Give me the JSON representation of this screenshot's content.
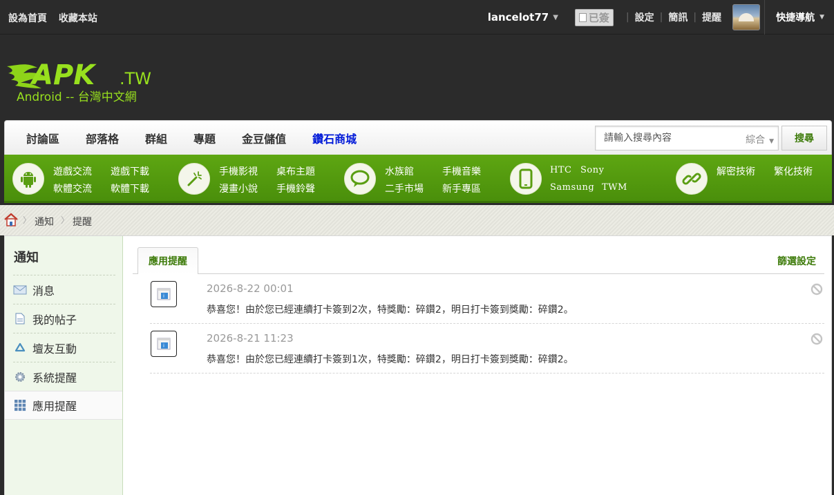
{
  "topbar": {
    "set_home": "設為首頁",
    "bookmark": "收藏本站",
    "username": "lancelot77",
    "signed_label": "已簽",
    "settings": "設定",
    "messages": "簡訊",
    "reminders": "提醒",
    "quick_nav": "快捷導航"
  },
  "logo": {
    "main": "APK",
    "suffix": ".TW",
    "sub": "Android -- 台灣中文網"
  },
  "nav": {
    "items": [
      "討論區",
      "部落格",
      "群組",
      "專題",
      "金豆儲值",
      "鑽石商城"
    ],
    "search_placeholder": "請輸入搜尋內容",
    "search_category": "綜合",
    "search_button": "搜尋"
  },
  "categories": [
    {
      "icon": "android-icon",
      "row1": [
        "遊戲交流",
        "遊戲下載"
      ],
      "row2": [
        "軟體交流",
        "軟體下載"
      ]
    },
    {
      "icon": "magic-wand-icon",
      "row1": [
        "手機影視",
        "桌布主題"
      ],
      "row2": [
        "漫畫小說",
        "手機鈴聲"
      ]
    },
    {
      "icon": "chat-bubble-icon",
      "row1": [
        "水族館",
        "手機音樂"
      ],
      "row2": [
        "二手市場",
        "新手專區"
      ]
    },
    {
      "icon": "phone-icon",
      "row1": [
        "HTC",
        "Sony"
      ],
      "row2": [
        "Samsung",
        "TWM"
      ]
    },
    {
      "icon": "link-icon",
      "row1": [
        "解密技術",
        "繁化技術"
      ],
      "row2": []
    }
  ],
  "breadcrumb": [
    "通知",
    "提醒"
  ],
  "sidebar": {
    "title": "通知",
    "items": [
      {
        "label": "消息",
        "icon": "envelope-icon"
      },
      {
        "label": "我的帖子",
        "icon": "document-icon"
      },
      {
        "label": "壇友互動",
        "icon": "recycle-icon"
      },
      {
        "label": "系統提醒",
        "icon": "gear-icon"
      },
      {
        "label": "應用提醒",
        "icon": "app-grid-icon"
      }
    ]
  },
  "main": {
    "tab": "應用提醒",
    "filter": "篩選設定",
    "notices": [
      {
        "date": "2026-8-22 00:01",
        "text": "恭喜您！由於您已經連續打卡簽到2次，特獎勵：碎鑽2，明日打卡簽到獎勵：碎鑽2。"
      },
      {
        "date": "2026-8-21 11:23",
        "text": "恭喜您！由於您已經連續打卡簽到1次，特獎勵：碎鑽2，明日打卡簽到獎勵：碎鑽2。"
      }
    ]
  },
  "colors": {
    "accent_green": "#4a8f0b",
    "link_green": "#3c7a08",
    "diamond_blue": "#0019d8",
    "topbar_bg": "#2b2b2b"
  }
}
